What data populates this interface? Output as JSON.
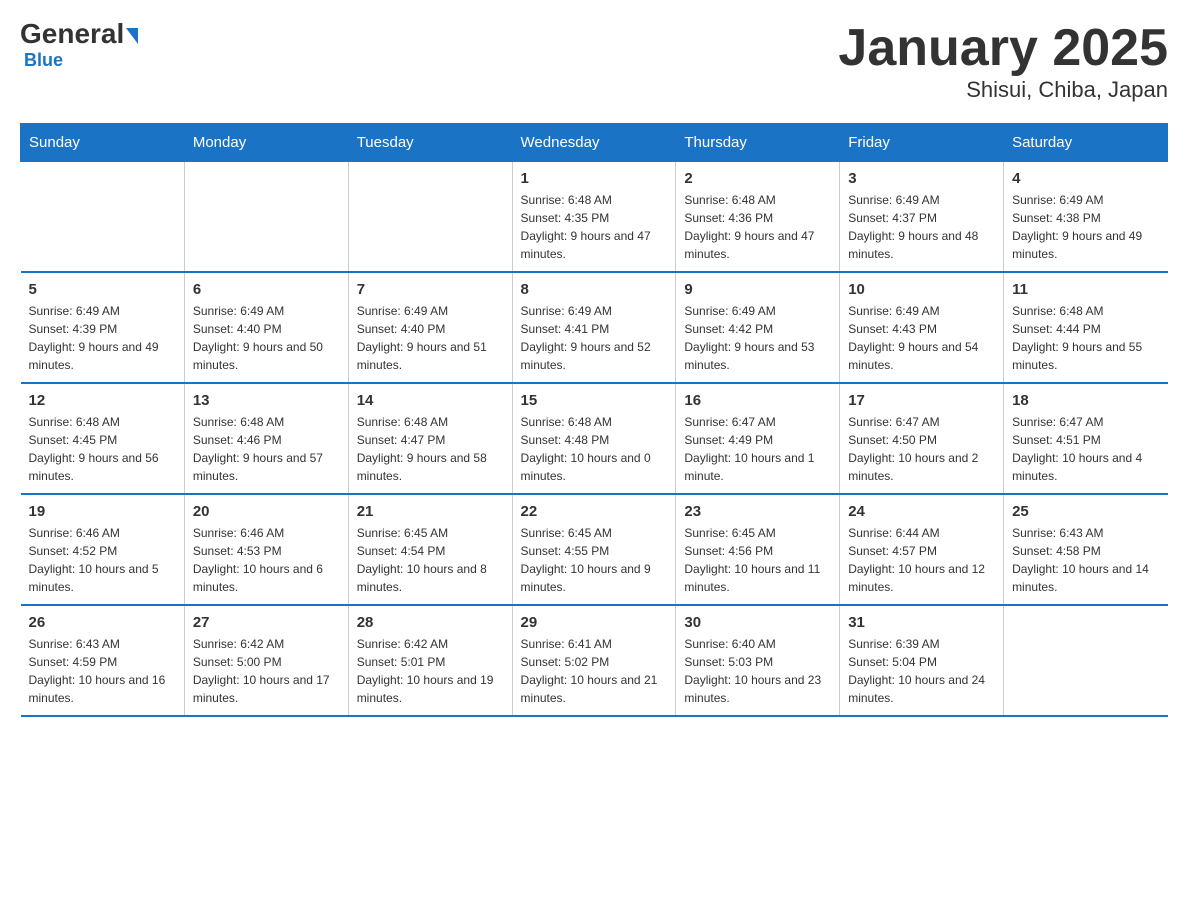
{
  "logo": {
    "general": "General",
    "blue": "Blue"
  },
  "title": "January 2025",
  "subtitle": "Shisui, Chiba, Japan",
  "days_of_week": [
    "Sunday",
    "Monday",
    "Tuesday",
    "Wednesday",
    "Thursday",
    "Friday",
    "Saturday"
  ],
  "weeks": [
    [
      {
        "day": "",
        "info": ""
      },
      {
        "day": "",
        "info": ""
      },
      {
        "day": "",
        "info": ""
      },
      {
        "day": "1",
        "info": "Sunrise: 6:48 AM\nSunset: 4:35 PM\nDaylight: 9 hours and 47 minutes."
      },
      {
        "day": "2",
        "info": "Sunrise: 6:48 AM\nSunset: 4:36 PM\nDaylight: 9 hours and 47 minutes."
      },
      {
        "day": "3",
        "info": "Sunrise: 6:49 AM\nSunset: 4:37 PM\nDaylight: 9 hours and 48 minutes."
      },
      {
        "day": "4",
        "info": "Sunrise: 6:49 AM\nSunset: 4:38 PM\nDaylight: 9 hours and 49 minutes."
      }
    ],
    [
      {
        "day": "5",
        "info": "Sunrise: 6:49 AM\nSunset: 4:39 PM\nDaylight: 9 hours and 49 minutes."
      },
      {
        "day": "6",
        "info": "Sunrise: 6:49 AM\nSunset: 4:40 PM\nDaylight: 9 hours and 50 minutes."
      },
      {
        "day": "7",
        "info": "Sunrise: 6:49 AM\nSunset: 4:40 PM\nDaylight: 9 hours and 51 minutes."
      },
      {
        "day": "8",
        "info": "Sunrise: 6:49 AM\nSunset: 4:41 PM\nDaylight: 9 hours and 52 minutes."
      },
      {
        "day": "9",
        "info": "Sunrise: 6:49 AM\nSunset: 4:42 PM\nDaylight: 9 hours and 53 minutes."
      },
      {
        "day": "10",
        "info": "Sunrise: 6:49 AM\nSunset: 4:43 PM\nDaylight: 9 hours and 54 minutes."
      },
      {
        "day": "11",
        "info": "Sunrise: 6:48 AM\nSunset: 4:44 PM\nDaylight: 9 hours and 55 minutes."
      }
    ],
    [
      {
        "day": "12",
        "info": "Sunrise: 6:48 AM\nSunset: 4:45 PM\nDaylight: 9 hours and 56 minutes."
      },
      {
        "day": "13",
        "info": "Sunrise: 6:48 AM\nSunset: 4:46 PM\nDaylight: 9 hours and 57 minutes."
      },
      {
        "day": "14",
        "info": "Sunrise: 6:48 AM\nSunset: 4:47 PM\nDaylight: 9 hours and 58 minutes."
      },
      {
        "day": "15",
        "info": "Sunrise: 6:48 AM\nSunset: 4:48 PM\nDaylight: 10 hours and 0 minutes."
      },
      {
        "day": "16",
        "info": "Sunrise: 6:47 AM\nSunset: 4:49 PM\nDaylight: 10 hours and 1 minute."
      },
      {
        "day": "17",
        "info": "Sunrise: 6:47 AM\nSunset: 4:50 PM\nDaylight: 10 hours and 2 minutes."
      },
      {
        "day": "18",
        "info": "Sunrise: 6:47 AM\nSunset: 4:51 PM\nDaylight: 10 hours and 4 minutes."
      }
    ],
    [
      {
        "day": "19",
        "info": "Sunrise: 6:46 AM\nSunset: 4:52 PM\nDaylight: 10 hours and 5 minutes."
      },
      {
        "day": "20",
        "info": "Sunrise: 6:46 AM\nSunset: 4:53 PM\nDaylight: 10 hours and 6 minutes."
      },
      {
        "day": "21",
        "info": "Sunrise: 6:45 AM\nSunset: 4:54 PM\nDaylight: 10 hours and 8 minutes."
      },
      {
        "day": "22",
        "info": "Sunrise: 6:45 AM\nSunset: 4:55 PM\nDaylight: 10 hours and 9 minutes."
      },
      {
        "day": "23",
        "info": "Sunrise: 6:45 AM\nSunset: 4:56 PM\nDaylight: 10 hours and 11 minutes."
      },
      {
        "day": "24",
        "info": "Sunrise: 6:44 AM\nSunset: 4:57 PM\nDaylight: 10 hours and 12 minutes."
      },
      {
        "day": "25",
        "info": "Sunrise: 6:43 AM\nSunset: 4:58 PM\nDaylight: 10 hours and 14 minutes."
      }
    ],
    [
      {
        "day": "26",
        "info": "Sunrise: 6:43 AM\nSunset: 4:59 PM\nDaylight: 10 hours and 16 minutes."
      },
      {
        "day": "27",
        "info": "Sunrise: 6:42 AM\nSunset: 5:00 PM\nDaylight: 10 hours and 17 minutes."
      },
      {
        "day": "28",
        "info": "Sunrise: 6:42 AM\nSunset: 5:01 PM\nDaylight: 10 hours and 19 minutes."
      },
      {
        "day": "29",
        "info": "Sunrise: 6:41 AM\nSunset: 5:02 PM\nDaylight: 10 hours and 21 minutes."
      },
      {
        "day": "30",
        "info": "Sunrise: 6:40 AM\nSunset: 5:03 PM\nDaylight: 10 hours and 23 minutes."
      },
      {
        "day": "31",
        "info": "Sunrise: 6:39 AM\nSunset: 5:04 PM\nDaylight: 10 hours and 24 minutes."
      },
      {
        "day": "",
        "info": ""
      }
    ]
  ]
}
